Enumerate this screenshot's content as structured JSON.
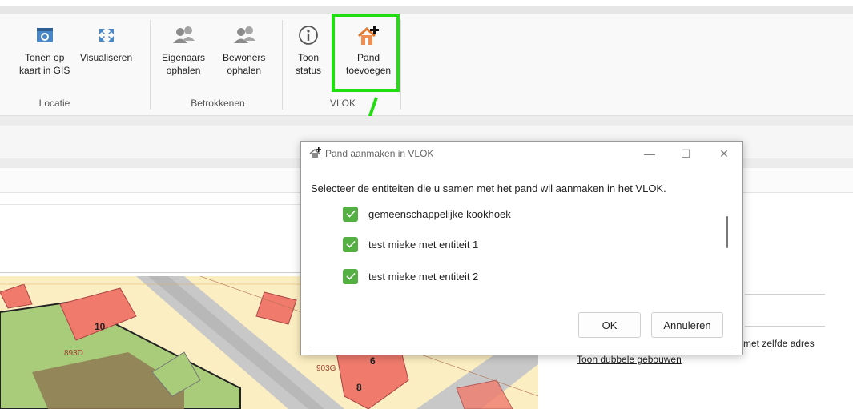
{
  "ribbon": {
    "buttons": {
      "tonen": "Tonen op\nkaart in GIS",
      "visualiseren": "Visualiseren",
      "eigenaars": "Eigenaars\nophalen",
      "bewoners": "Bewoners\nophalen",
      "toon_status": "Toon\nstatus",
      "pand_toevoegen": "Pand\ntoevoegen"
    },
    "groups": {
      "locatie": "Locatie",
      "betrokkenen": "Betrokkenen",
      "vlok": "VLOK"
    }
  },
  "dialog": {
    "title": "Pand aanmaken in VLOK",
    "prompt": "Selecteer de entiteiten die u samen met het pand wil aanmaken in het VLOK.",
    "items": [
      "gemeenschappelijke kookhoek",
      "test mieke met entiteit 1",
      "test mieke met entiteit 2"
    ],
    "ok_label": "OK",
    "cancel_label": "Annuleren"
  },
  "map": {
    "labels": [
      "10",
      "893D",
      "903G",
      "6",
      "8"
    ]
  },
  "side": {
    "text": "met zelfde adres",
    "link": "Toon dubbele gebouwen"
  },
  "colors": {
    "highlight": "#22dd11",
    "checkbox": "#54b042",
    "parcel": "#fbeec2",
    "building": "#f07b6c",
    "green_area": "#a9cc7a",
    "road": "#c8c8c8"
  }
}
